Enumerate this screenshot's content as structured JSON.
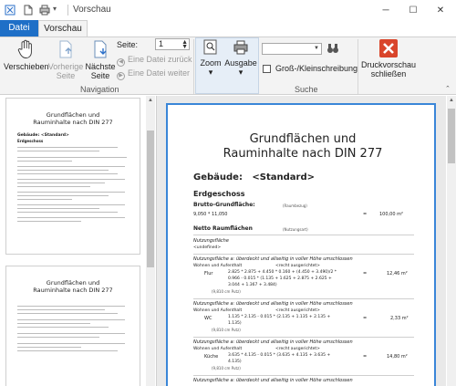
{
  "titlebar": {
    "title": "Vorschau",
    "minimize": "─",
    "maximize": "☐",
    "close": "✕"
  },
  "tabs": [
    {
      "label": "Datei",
      "active": false
    },
    {
      "label": "Vorschau",
      "active": true
    }
  ],
  "ribbon": {
    "navigation": {
      "label": "Navigation",
      "verschieben": "Verschieben",
      "vorherige_seite_1": "Vorherige",
      "vorherige_seite_2": "Seite",
      "naechste_seite_1": "Nächste",
      "naechste_seite_2": "Seite",
      "seite_label": "Seite:",
      "seite_value": "1",
      "datei_zurueck": "Eine Datei zurück",
      "datei_weiter": "Eine Datei weiter"
    },
    "zoom": {
      "label": "Zoom"
    },
    "ausgabe": {
      "label": "Ausgabe"
    },
    "suche": {
      "label": "Suche",
      "input_value": "",
      "case_label": "Groß-/Kleinschreibung",
      "case_checked": false
    },
    "close_preview_1": "Druckvorschau",
    "close_preview_2": "schließen"
  },
  "thumbnails": [
    {
      "title_1": "Grundflächen und",
      "title_2": "Rauminhalte nach DIN 277",
      "label_1": "Gebäude:   <Standard>",
      "label_2": "Erdgeschoss"
    },
    {
      "title_1": "Grundflächen und",
      "title_2": "Rauminhalte nach DIN 277"
    }
  ],
  "document": {
    "title_1": "Grundflächen und",
    "title_2": "Rauminhalte nach DIN 277",
    "building_label": "Gebäude:",
    "building_value": "<Standard>",
    "floor": "Erdgeschoss",
    "bgf_label": "Brutto-Grundfläche:",
    "bgf_note": "(Raumbezug)",
    "bgf_formula": "9,050 * 11,050",
    "bgf_eq": "=",
    "bgf_value": "100,00 m²",
    "nrf_label": "Netto Raumflächen",
    "nrf_note": "(Nutzungsart)",
    "nutzung_label": "Nutzungsfläche",
    "nutzung_undef": "<undefined>",
    "section_heading": "Nutzungsfläche a: überdeckt und allseitig in voller Höhe umschlossen",
    "rooms": [
      {
        "group": "Wohnen und Aufenthalt",
        "reckt": "<recht ausgerichtet>",
        "name": "Flur",
        "formula_1": "2.825 * 2.875 + 4.450 * 0.160 + (4.450 + 3.490)/2 *",
        "formula_2": "0.966 - 0.015 * (1.135 + 1.625 + 2.875 + 2.625 +",
        "formula_3": "3.044 + 1.367 + 3.484)",
        "unit_note": "(9,810 cm Putz)",
        "eq": "=",
        "value": "12,46 m²"
      },
      {
        "group": "Wohnen und Aufenthalt",
        "reckt": "<recht ausgerichtet>",
        "name": "WC",
        "formula_1": "1.135 * 2.135 - 0.015 * (2.135 + 1.135 + 2.135 +",
        "formula_2": "1.135)",
        "unit_note": "(9,810 cm Putz)",
        "eq": "=",
        "value": "2,33 m²"
      },
      {
        "group": "Wohnen und Aufenthalt",
        "reckt": "<recht ausgerichtet>",
        "name": "Küche",
        "formula_1": "3.635 * 4.135 - 0.015 * (3.635 + 4.135 + 3.635 +",
        "formula_2": "4.135)",
        "unit_note": "(9,810 cm Putz)",
        "eq": "=",
        "value": "14,80 m²"
      }
    ]
  },
  "colors": {
    "accent": "#1e6fc7",
    "page_border": "#3a86d8",
    "close_icon": "#d9452b"
  }
}
